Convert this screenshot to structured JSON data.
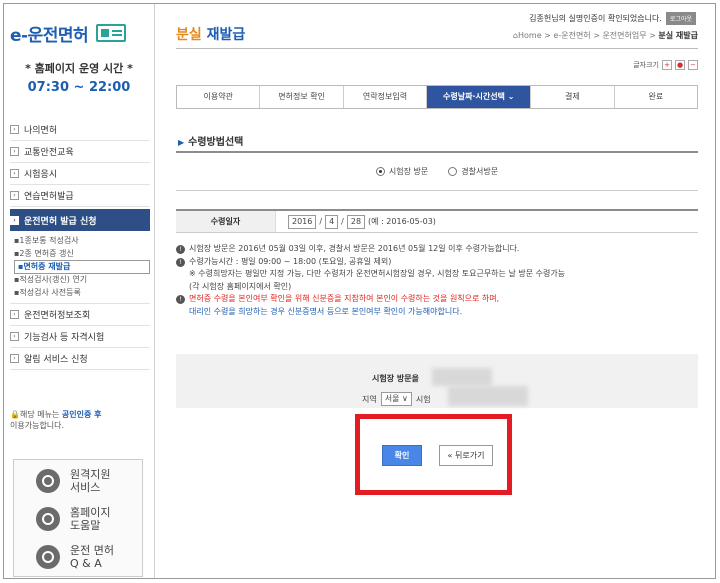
{
  "sidebar": {
    "logo": "e-운전면허",
    "hours_title": "* 홈페이지 운영 시간 *",
    "hours_time": "07:30 ~ 22:00",
    "menu_top": [
      "나의면허",
      "교통안전교육",
      "시험응시",
      "연습면허발급"
    ],
    "menu_active": "운전면허 발급 신청",
    "submenu": [
      "1종보통 적성검사",
      "2종 면허증 갱신",
      "면허증 재발급",
      "적성검사(갱신) 연기",
      "적성검사 사전등록"
    ],
    "submenu_selected_index": 2,
    "menu_bottom": [
      "운전면허정보조회",
      "기능검사 등 자격시험",
      "알림 서비스 신청"
    ],
    "note_prefix": "해당 메뉴는 ",
    "note_link": "공인인증 후",
    "note_suffix": "이용가능합니다.",
    "quick": [
      {
        "label_1": "원격지원",
        "label_2": "서비스",
        "icon": "remote-support-icon"
      },
      {
        "label_1": "홈페이지",
        "label_2": "도움말",
        "icon": "help-icon"
      },
      {
        "label_1": "운전 면허",
        "label_2": "Q & A",
        "icon": "qa-search-icon"
      }
    ]
  },
  "header": {
    "title_orange": "분실",
    "title_blue": " 재발급",
    "login_msg": "김종헌님의 실명인증이 확인되었습니다.",
    "logout": "로그아웃",
    "breadcrumb": "Home > e-운전면허 > 운전면허업무 > ",
    "breadcrumb_current": "분실 재발급",
    "zoom_label": "글자크기",
    "zoom_plus": "+",
    "zoom_reset": "●",
    "zoom_minus": "−"
  },
  "steps": [
    "이용약관",
    "면허정보 확인",
    "연락정보입력",
    "수령날짜·시간선택 ⌄",
    "결제",
    "완료"
  ],
  "active_step_index": 3,
  "section_title": "수령방법선택",
  "method": {
    "option_1": "시험장 방문",
    "option_2": "경찰서방문",
    "selected": 1
  },
  "date": {
    "label": "수령일자",
    "year": "2016",
    "month": "4",
    "day": "28",
    "example": "(예 : 2016-05-03)"
  },
  "notes": {
    "n1": "시험장 방문은 2016년 05월 03일 이후, 경찰서 방문은 2016년 05월 12일 이후 수령가능합니다.",
    "n2": "수령가능시간 : 평일 09:00 ~ 18:00 (토요일, 공휴일 제외)",
    "n2_sub1": "※ 수령희망자는 평일만 지정 가능, 다만 수령처가 운전면허시험장일 경우, 시험장 토요근무하는 날 방문 수령가능",
    "n2_sub2": "(각 시험장 홈페이지에서 확인)",
    "n3_red": "면허증 수령을 본인여부 확인을 위해 신분증을 지참하여 본인이 수령하는 것을 원칙으로 하며,",
    "n3_blue": "대리인 수령을 희망하는 경우 신분증명서 등으로 본인여부 확인이 가능해야합니다."
  },
  "visit": {
    "title": "시험장 방문을",
    "region_label": "지역",
    "region_value": "서울 ∨",
    "site_label": "시험"
  },
  "buttons": {
    "confirm": "확인",
    "back": "« 뒤로가기"
  }
}
